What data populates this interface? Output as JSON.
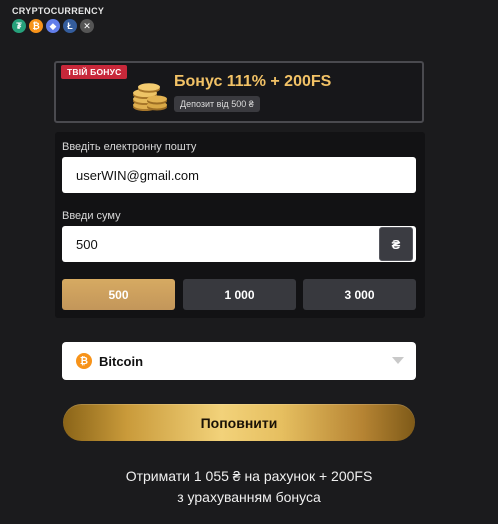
{
  "header": {
    "title": "CRYPTOCURRENCY",
    "coins": [
      {
        "icon": "tether-icon",
        "glyph": "₮",
        "color": "#26a17b"
      },
      {
        "icon": "bitcoin-icon",
        "glyph": "₿",
        "color": "#f7931a"
      },
      {
        "icon": "ethereum-icon",
        "glyph": "◆",
        "color": "#627eea"
      },
      {
        "icon": "litecoin-icon",
        "glyph": "Ł",
        "color": "#345d9d"
      },
      {
        "icon": "xrp-icon",
        "glyph": "✕",
        "color": "#555555"
      }
    ]
  },
  "bonus": {
    "tag": "ТВІЙ БОНУС",
    "title": "Бонус 111% + 200FS",
    "deposit": "Депозит від 500 ₴"
  },
  "form": {
    "email_label": "Введіть електронну пошту",
    "email_value": "userWIN@gmail.com",
    "amount_label": "Введи суму",
    "amount_value": "500",
    "currency_symbol": "₴",
    "presets": [
      "500",
      "1 000",
      "3 000"
    ],
    "active_preset": "500"
  },
  "payment": {
    "selected": "Bitcoin",
    "icon": "bitcoin-icon",
    "icon_color": "#f7931a"
  },
  "cta": {
    "label": "Поповнити"
  },
  "summary": {
    "line1": "Отримати 1 055 ₴ на рахунок + 200FS",
    "line2": "з урахуванням бонуса"
  }
}
